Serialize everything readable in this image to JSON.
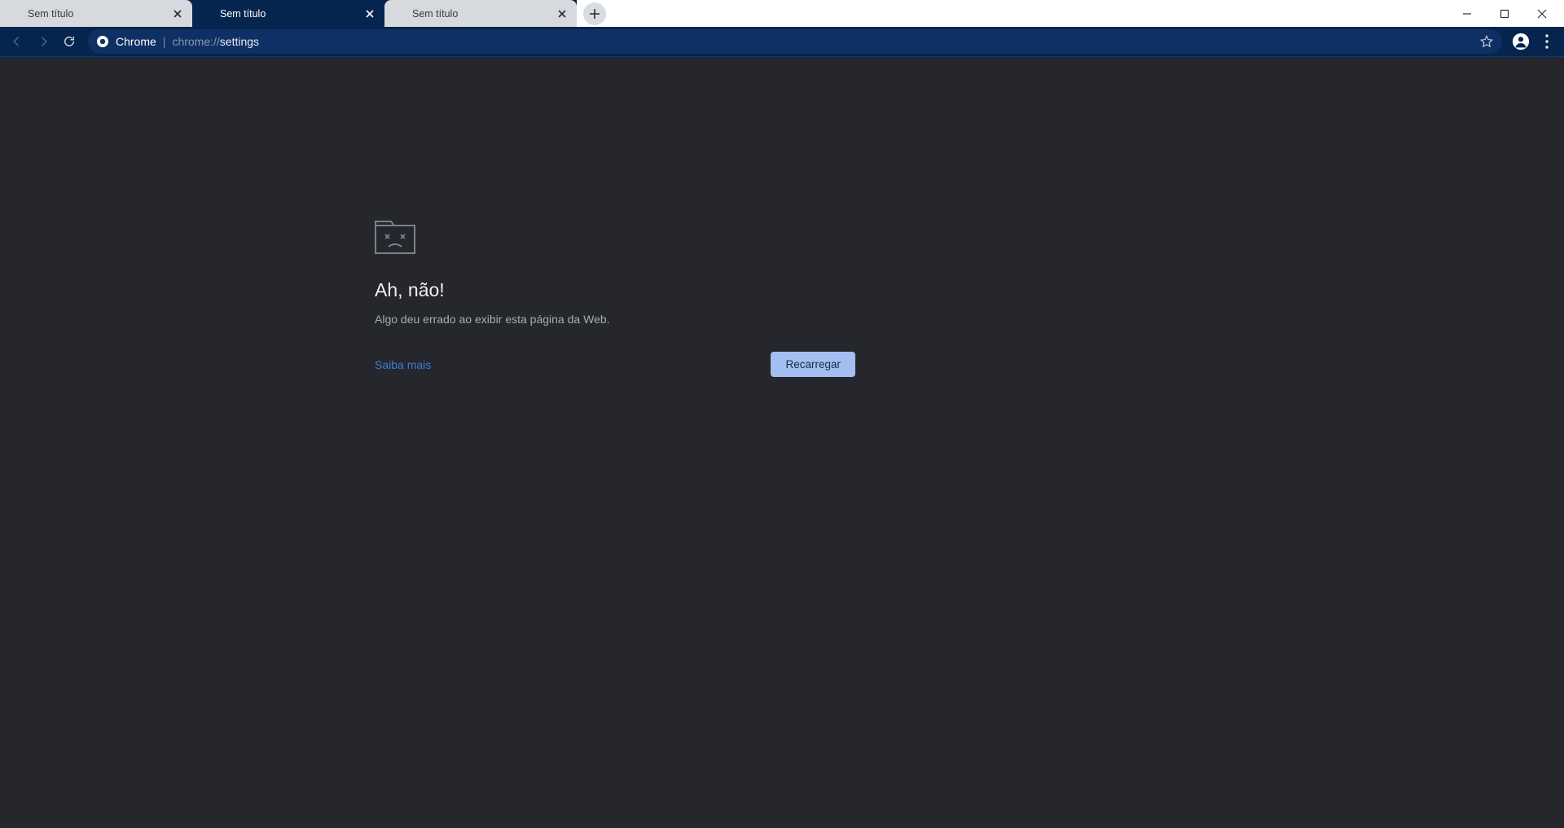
{
  "tabs": [
    {
      "title": "Sem título",
      "active": false
    },
    {
      "title": "Sem título",
      "active": true
    },
    {
      "title": "Sem título",
      "active": false
    }
  ],
  "omnibox": {
    "origin_label": "Chrome",
    "url_scheme": "chrome://",
    "url_path": "settings"
  },
  "error": {
    "title": "Ah, não!",
    "message": "Algo deu errado ao exibir esta página da Web.",
    "learn_more": "Saiba mais",
    "reload": "Recarregar"
  }
}
